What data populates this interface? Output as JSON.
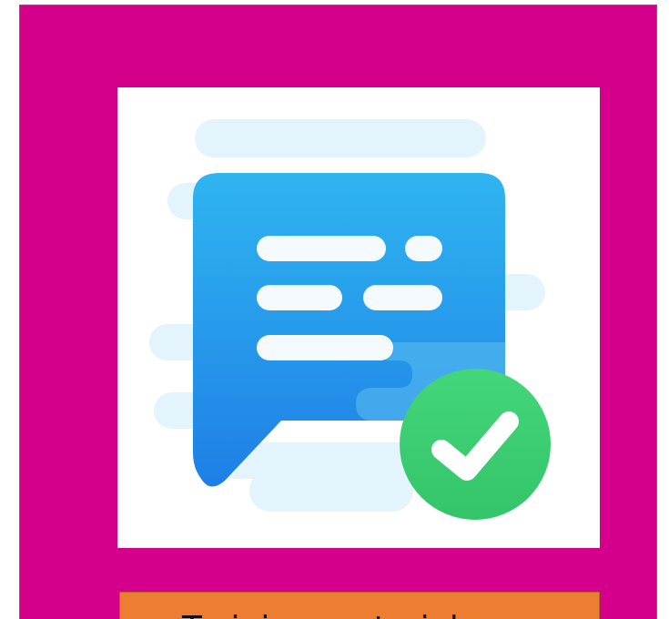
{
  "colors": {
    "outer_background": "#d4008c",
    "panel_background": "#ffffff",
    "caption_background": "#ed7d31",
    "bubble_top": "#2fb5f0",
    "bubble_bottom": "#1e7fe6",
    "check_badge": "#34c46a",
    "cloud": "#e3f4fc"
  },
  "icons": {
    "main_icon": "chat-bubble-with-check-icon"
  },
  "caption": {
    "text": "Training material"
  }
}
